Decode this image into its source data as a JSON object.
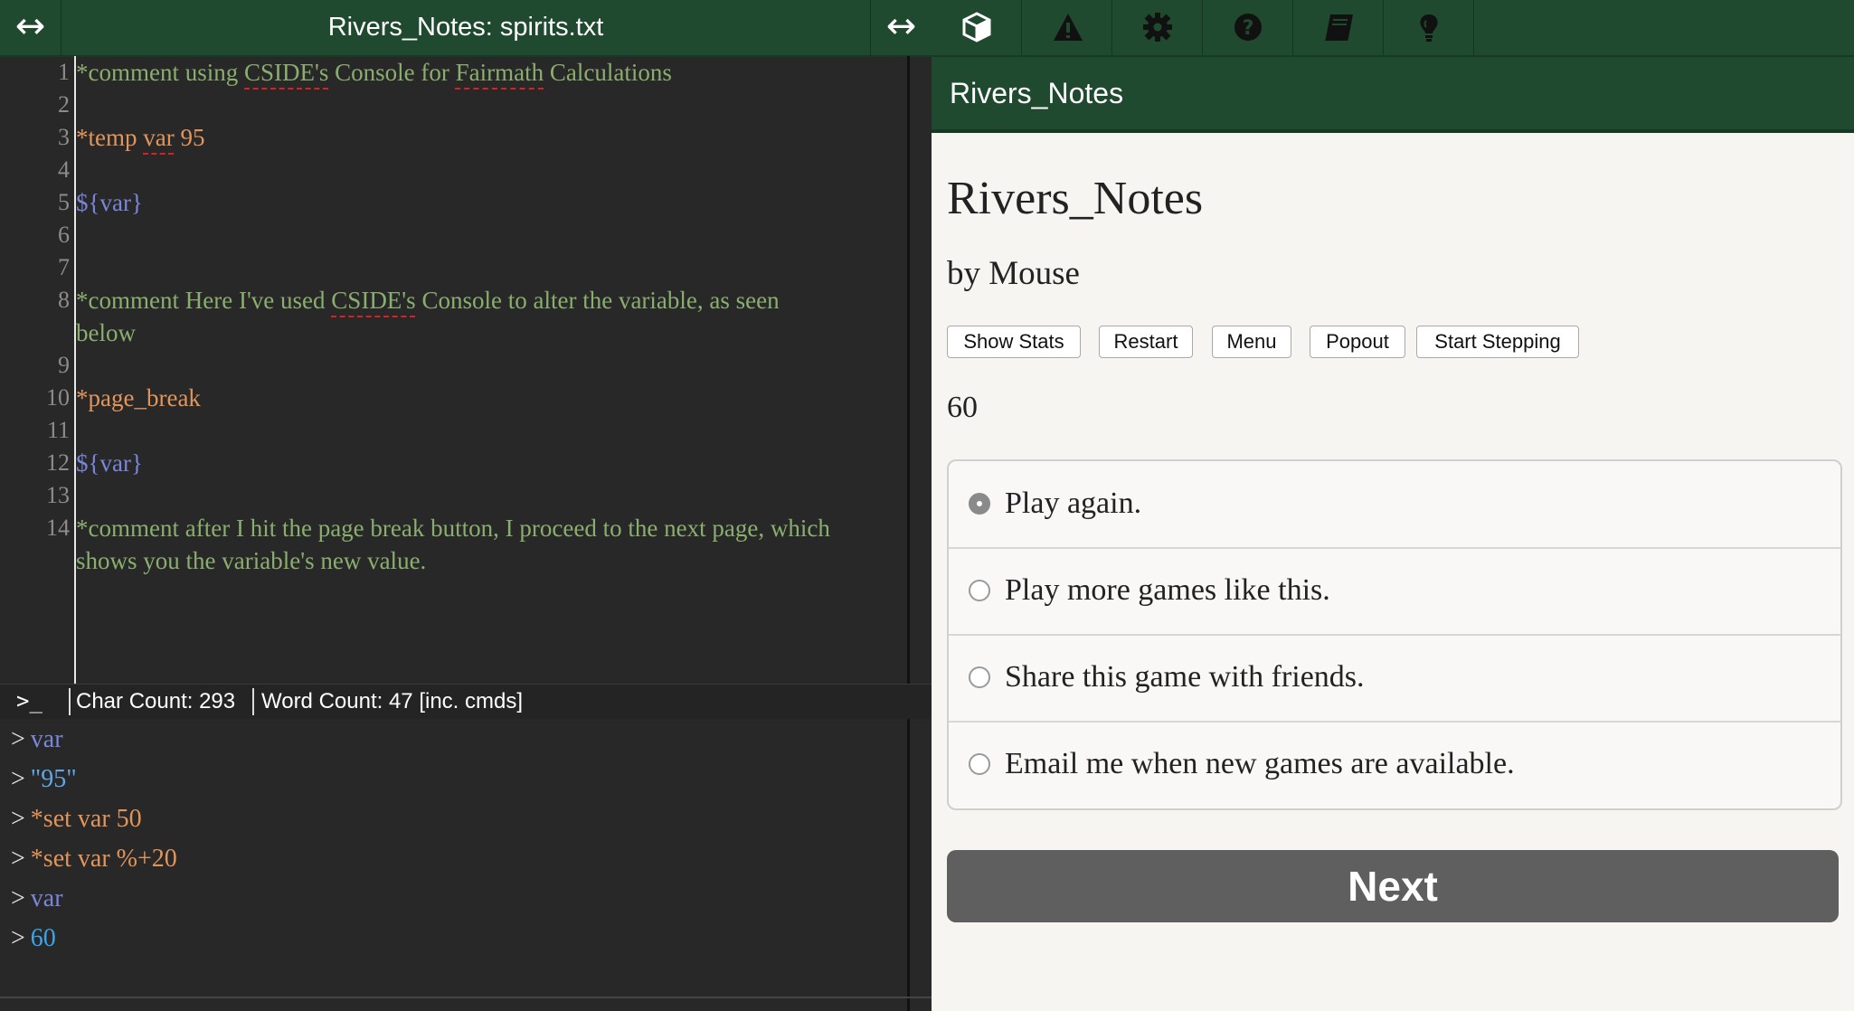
{
  "editor": {
    "title": "Rivers_Notes: spirits.txt",
    "expand_icon": "↔",
    "lines": [
      {
        "num": "1",
        "text": "*comment using CSIDE's Console for Fairmath Calculations"
      },
      {
        "num": "2",
        "text": ""
      },
      {
        "num": "3",
        "text": "*temp var 95"
      },
      {
        "num": "4",
        "text": ""
      },
      {
        "num": "5",
        "text": "${var}"
      },
      {
        "num": "6",
        "text": ""
      },
      {
        "num": "7",
        "text": ""
      },
      {
        "num": "8",
        "text": "*comment Here I've used CSIDE's Console to alter the variable, as seen below"
      },
      {
        "num": "9",
        "text": ""
      },
      {
        "num": "10",
        "text": "*page_break"
      },
      {
        "num": "11",
        "text": ""
      },
      {
        "num": "12",
        "text": "${var}"
      },
      {
        "num": "13",
        "text": ""
      },
      {
        "num": "14",
        "text": "*comment after I hit the page break button, I proceed to the next page, which shows you the variable's new value."
      }
    ]
  },
  "status_bar": {
    "console_icon": ">_",
    "char_count": "Char Count: 293",
    "word_count": "Word Count: 47 [inc. cmds]"
  },
  "console": {
    "prompt": ">",
    "entries": [
      "var",
      "\"95\"",
      "*set var 50",
      "*set var %+20",
      "var",
      "60"
    ]
  },
  "toolbar": {
    "icons": [
      "cube-icon",
      "warning-icon",
      "gear-icon",
      "help-icon",
      "book-icon",
      "lightbulb-icon"
    ]
  },
  "game": {
    "header": "Rivers_Notes",
    "title": "Rivers_Notes",
    "author": "by Mouse",
    "buttons": [
      "Show Stats",
      "Restart",
      "Menu",
      "Popout",
      "Start Stepping"
    ],
    "value": "60",
    "choices": [
      "Play again.",
      "Play more games like this.",
      "Share this game with friends.",
      "Email me when new games are available."
    ],
    "selected_choice": "Play again.",
    "next_label": "Next"
  },
  "colors": {
    "header_green": "#1f4a2f",
    "comment": "#8aae6e",
    "command": "#e2955b",
    "variable": "#7a86d8",
    "console_number": "#39a6ea"
  }
}
